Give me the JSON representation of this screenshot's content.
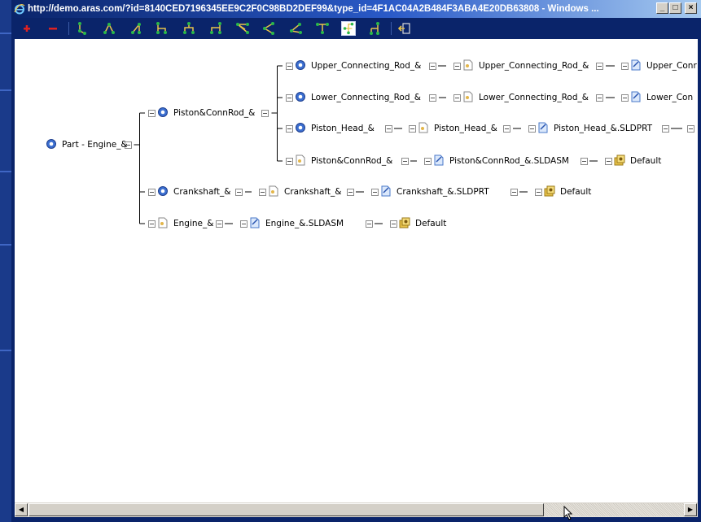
{
  "window": {
    "title": "http://demo.aras.com/?id=8140CED7196345EE9C2F0C98BD2DEF99&type_id=4F1AC04A2B484F3ABA4E20DB63808 - Windows ...",
    "buttons": {
      "minimize": "_",
      "maximize": "□",
      "close": "×"
    }
  },
  "toolbar": {
    "tools": [
      {
        "name": "expand",
        "icon": "plus-icon"
      },
      {
        "name": "collapse",
        "icon": "minus-icon"
      },
      {
        "name": "layout-1",
        "icon": "tree-layout-icon"
      },
      {
        "name": "layout-2",
        "icon": "tree-layout-icon"
      },
      {
        "name": "layout-3",
        "icon": "tree-layout-icon"
      },
      {
        "name": "layout-4",
        "icon": "tree-layout-icon"
      },
      {
        "name": "layout-5",
        "icon": "tree-layout-icon"
      },
      {
        "name": "layout-6",
        "icon": "tree-layout-icon"
      },
      {
        "name": "layout-7",
        "icon": "tree-layout-icon"
      },
      {
        "name": "layout-8",
        "icon": "tree-layout-icon"
      },
      {
        "name": "layout-9",
        "icon": "tree-layout-icon"
      },
      {
        "name": "layout-10",
        "icon": "tree-layout-icon"
      },
      {
        "name": "layout-11",
        "icon": "tree-layout-icon"
      },
      {
        "name": "layout-12",
        "icon": "tree-layout-icon"
      },
      {
        "name": "exit",
        "icon": "exit-icon"
      }
    ]
  },
  "tree": {
    "root": {
      "label": "Part - Engine_&",
      "icon": "part-icon"
    },
    "piston_connrod": {
      "label": "Piston&ConnRod_&",
      "icon": "part-icon"
    },
    "upper_part": {
      "label": "Upper_Connecting_Rod_&",
      "icon": "part-icon"
    },
    "upper_doc": {
      "label": "Upper_Connecting_Rod_&",
      "icon": "document-icon"
    },
    "upper_cad": {
      "label": "Upper_Conr",
      "icon": "cad-file-icon"
    },
    "lower_part": {
      "label": "Lower_Connecting_Rod_&",
      "icon": "part-icon"
    },
    "lower_doc": {
      "label": "Lower_Connecting_Rod_&",
      "icon": "document-icon"
    },
    "lower_cad": {
      "label": "Lower_Con",
      "icon": "cad-file-icon"
    },
    "piston_head_part": {
      "label": "Piston_Head_&",
      "icon": "part-icon"
    },
    "piston_head_doc": {
      "label": "Piston_Head_&",
      "icon": "document-icon"
    },
    "piston_head_cad": {
      "label": "Piston_Head_&.SLDPRT",
      "icon": "cad-file-icon"
    },
    "pcr_doc": {
      "label": "Piston&ConnRod_&",
      "icon": "document-icon"
    },
    "pcr_cad": {
      "label": "Piston&ConnRod_&.SLDASM",
      "icon": "cad-file-icon"
    },
    "pcr_default": {
      "label": "Default",
      "icon": "configuration-icon"
    },
    "crank_part": {
      "label": "Crankshaft_&",
      "icon": "part-icon"
    },
    "crank_doc": {
      "label": "Crankshaft_&",
      "icon": "document-icon"
    },
    "crank_cad": {
      "label": "Crankshaft_&.SLDPRT",
      "icon": "cad-file-icon"
    },
    "crank_default": {
      "label": "Default",
      "icon": "configuration-icon"
    },
    "engine_doc": {
      "label": "Engine_&",
      "icon": "document-icon"
    },
    "engine_cad": {
      "label": "Engine_&.SLDASM",
      "icon": "cad-file-icon"
    },
    "engine_default": {
      "label": "Default",
      "icon": "configuration-icon"
    }
  },
  "scrollbar": {
    "left_arrow": "◀",
    "right_arrow": "▶"
  }
}
